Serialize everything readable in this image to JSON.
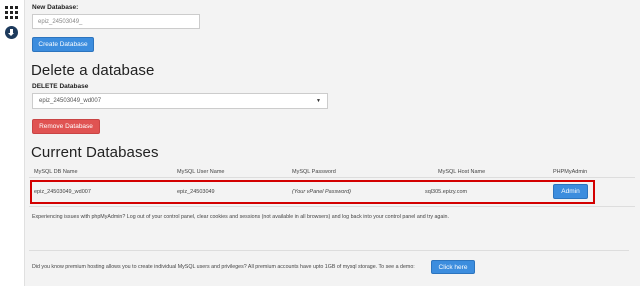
{
  "new_database": {
    "label": "New Database:",
    "input_value": "epiz_24503049_",
    "create_button": "Create Database"
  },
  "delete_section": {
    "heading": "Delete a database",
    "label": "DELETE Database",
    "selected": "epiz_24503049_wd007",
    "remove_button": "Remove Database"
  },
  "current": {
    "heading": "Current Databases",
    "columns": [
      "MySQL DB Name",
      "MySQL User Name",
      "MySQL Password",
      "MySQL Host Name",
      "PHPMyAdmin"
    ],
    "row": {
      "db_name": "epiz_24503049_wd007",
      "user_name": "epiz_24503049",
      "password": "(Your vPanel Password)",
      "host_name": "sql305.epizy.com",
      "admin_button": "Admin"
    }
  },
  "help_text": "Experiencing issues with phpMyAdmin? Log out of your control panel, clear cookies and sessions (not available in all browsers) and log back into your control panel and try again.",
  "promo": {
    "text": "Did you know premium hosting allows you to create individual MySQL users and privileges? All premium accounts have upto 1GB of mysql storage. To see a demo:",
    "button": "Click here"
  },
  "colors": {
    "primary": "#3c8dde",
    "danger": "#e05352",
    "highlight": "#d30000"
  }
}
